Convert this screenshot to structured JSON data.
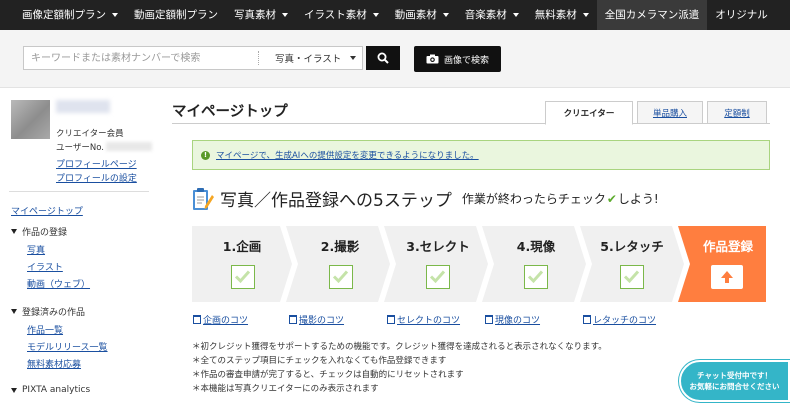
{
  "topnav": {
    "items": [
      {
        "label": "画像定額制プラン",
        "has_caret": true
      },
      {
        "label": "動画定額制プラン",
        "has_caret": false
      },
      {
        "label": "写真素材",
        "has_caret": true
      },
      {
        "label": "イラスト素材",
        "has_caret": true
      },
      {
        "label": "動画素材",
        "has_caret": true
      },
      {
        "label": "音楽素材",
        "has_caret": true
      },
      {
        "label": "無料素材",
        "has_caret": true
      },
      {
        "label": "全国カメラマン派遣",
        "has_caret": false
      },
      {
        "label": "オリジナル",
        "has_caret": false
      }
    ]
  },
  "search": {
    "placeholder": "キーワードまたは素材ナンバーで検索",
    "type_selected": "写真・イラスト",
    "image_search_label": "画像で検索"
  },
  "sidebar": {
    "member_type": "クリエイター会員",
    "user_no_label": "ユーザーNo.",
    "profile_page": "プロフィールページ",
    "profile_settings": "プロフィールの設定",
    "mypage_top": "マイページトップ",
    "sections": [
      {
        "title": "作品の登録",
        "links": [
          "写真",
          "イラスト",
          "動画（ウェブ）"
        ]
      },
      {
        "title": "登録済みの作品",
        "links": [
          "作品一覧",
          "モデルリリース一覧",
          "無料素材応募"
        ]
      },
      {
        "title": "PIXTA analytics",
        "links": []
      }
    ]
  },
  "main": {
    "title": "マイページトップ",
    "tabs": [
      "クリエイター",
      "単品購入",
      "定額制"
    ],
    "notice": "マイページで、生成AIへの提供設定を変更できるようになりました。",
    "steps_title": "写真／作品登録への5ステップ",
    "steps_sub_before": "作業が終わったらチェック",
    "steps_sub_after": "しよう!",
    "steps": [
      "1.企画",
      "2.撮影",
      "3.セレクト",
      "4.現像",
      "5.レタッチ"
    ],
    "final_step": "作品登録",
    "tips": [
      "企画のコツ",
      "撮影のコツ",
      "セレクトのコツ",
      "現像のコツ",
      "レタッチのコツ"
    ],
    "notes": [
      "＊初クレジット獲得をサポートするための機能です。クレジット獲得を達成されると表示されなくなります。",
      "＊全てのステップ項目にチェックを入れなくても作品登録できます",
      "＊作品の審査申請が完了すると、チェックは自動的にリセットされます",
      "＊本機能は写真クリエイターにのみ表示されます"
    ]
  },
  "chat": {
    "line1": "チャット受付中です！",
    "line2": "お気軽にお問合せください"
  },
  "colors": {
    "nav_bg": "#222222",
    "step_bg": "#f0f0f0",
    "final_step_bg": "#ff7e3f",
    "notice_bg": "#eaf6de",
    "check_green": "#5cab2d",
    "link_blue": "#1a4fa0",
    "chat_bg": "#34b5c8"
  }
}
